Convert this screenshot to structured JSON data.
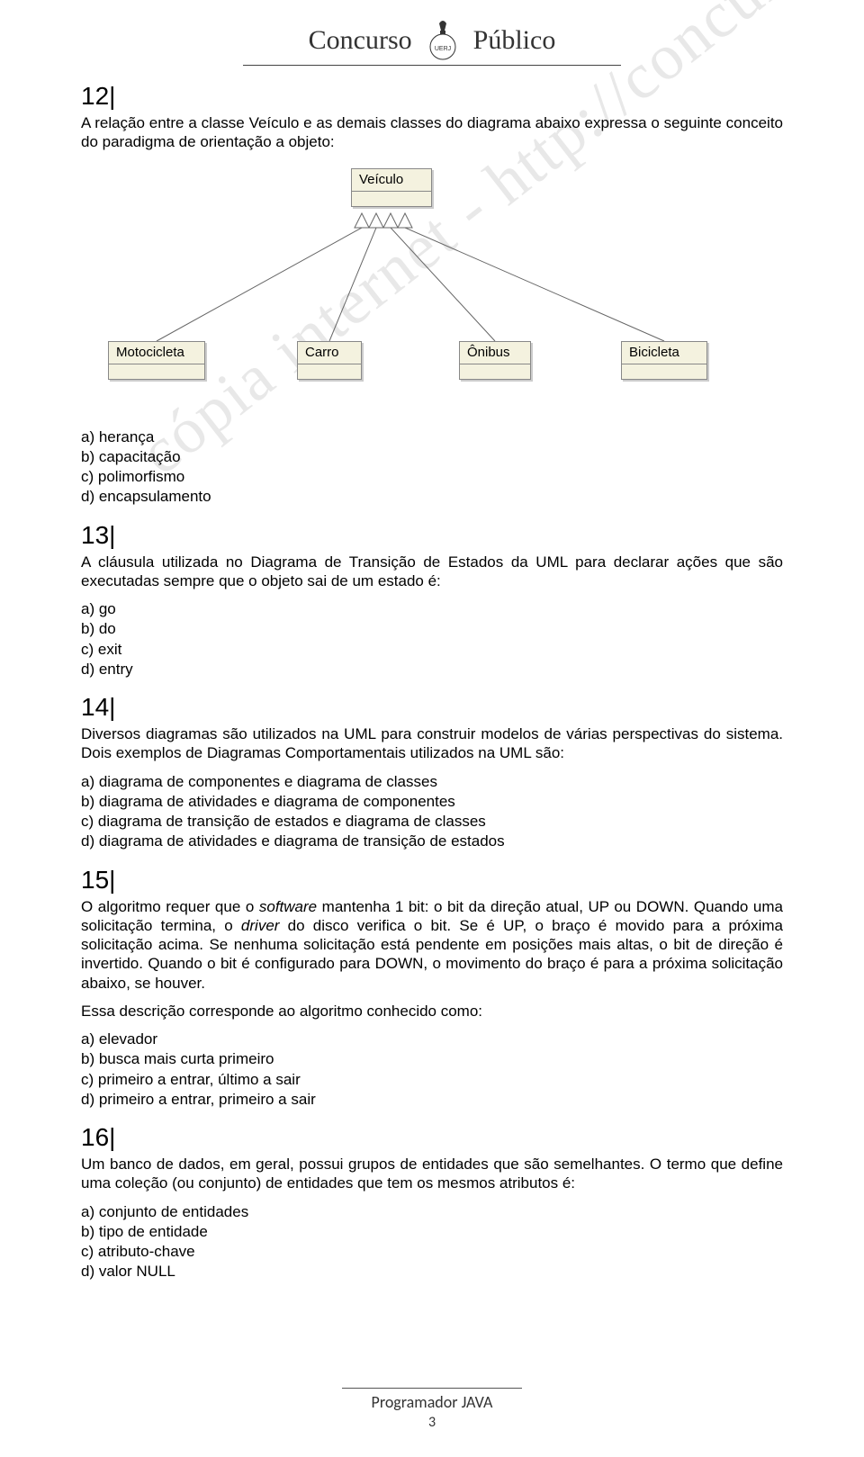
{
  "header": {
    "left": "Concurso",
    "right": "Público",
    "logo_alt": "UERJ"
  },
  "watermark": "cópia internet - http://concursos.srh.uerj.br/",
  "diagram": {
    "parent": "Veículo",
    "children": [
      "Motocicleta",
      "Carro",
      "Ônibus",
      "Bicicleta"
    ]
  },
  "q12": {
    "num": "12",
    "text": "A relação entre a classe Veículo e as demais classes do diagrama abaixo expressa o seguinte conceito do paradigma de orientação a objeto:",
    "opts": {
      "a": "a) herança",
      "b": "b) capacitação",
      "c": "c) polimorfismo",
      "d": "d) encapsulamento"
    }
  },
  "q13": {
    "num": "13",
    "text": "A cláusula utilizada no Diagrama de Transição de Estados da UML para declarar ações que são executadas sempre que o objeto sai de um estado é:",
    "opts": {
      "a": "a) go",
      "b": "b) do",
      "c": "c) exit",
      "d": "d) entry"
    }
  },
  "q14": {
    "num": "14",
    "text": "Diversos diagramas são utilizados na UML para construir modelos de várias perspectivas do sistema. Dois exemplos de Diagramas Comportamentais utilizados na UML são:",
    "opts": {
      "a": "a) diagrama de componentes e diagrama de classes",
      "b": "b) diagrama de atividades e diagrama de componentes",
      "c": "c) diagrama de transição de estados e diagrama de classes",
      "d": "d) diagrama de atividades e diagrama de transição de estados"
    }
  },
  "q15": {
    "num": "15",
    "text_parts": {
      "p1a": "O algoritmo requer que o ",
      "p1b": "software",
      "p1c": " mantenha 1 bit: o bit da direção atual, UP ou DOWN. Quando uma solicitação termina, o ",
      "p1d": "driver",
      "p1e": " do disco verifica o bit. Se é UP, o braço é movido para a próxima solicitação acima. Se nenhuma solicitação está pendente em posições mais altas, o bit de direção é invertido. Quando o bit é configurado para DOWN, o movimento do braço é para a próxima solicitação abaixo, se houver."
    },
    "subtext": "Essa descrição corresponde ao algoritmo conhecido como:",
    "opts": {
      "a": "a) elevador",
      "b": "b) busca mais curta primeiro",
      "c": "c) primeiro a entrar, último a sair",
      "d": "d) primeiro a entrar, primeiro a sair"
    }
  },
  "q16": {
    "num": "16",
    "text": "Um banco de dados, em geral, possui grupos de entidades que são semelhantes. O termo que define uma coleção (ou conjunto) de entidades que tem os mesmos atributos é:",
    "opts": {
      "a": "a) conjunto de entidades",
      "b": "b) tipo de entidade",
      "c": "c) atributo-chave",
      "d": "d) valor NULL"
    }
  },
  "footer": {
    "title": "Programador JAVA",
    "page": "3"
  }
}
